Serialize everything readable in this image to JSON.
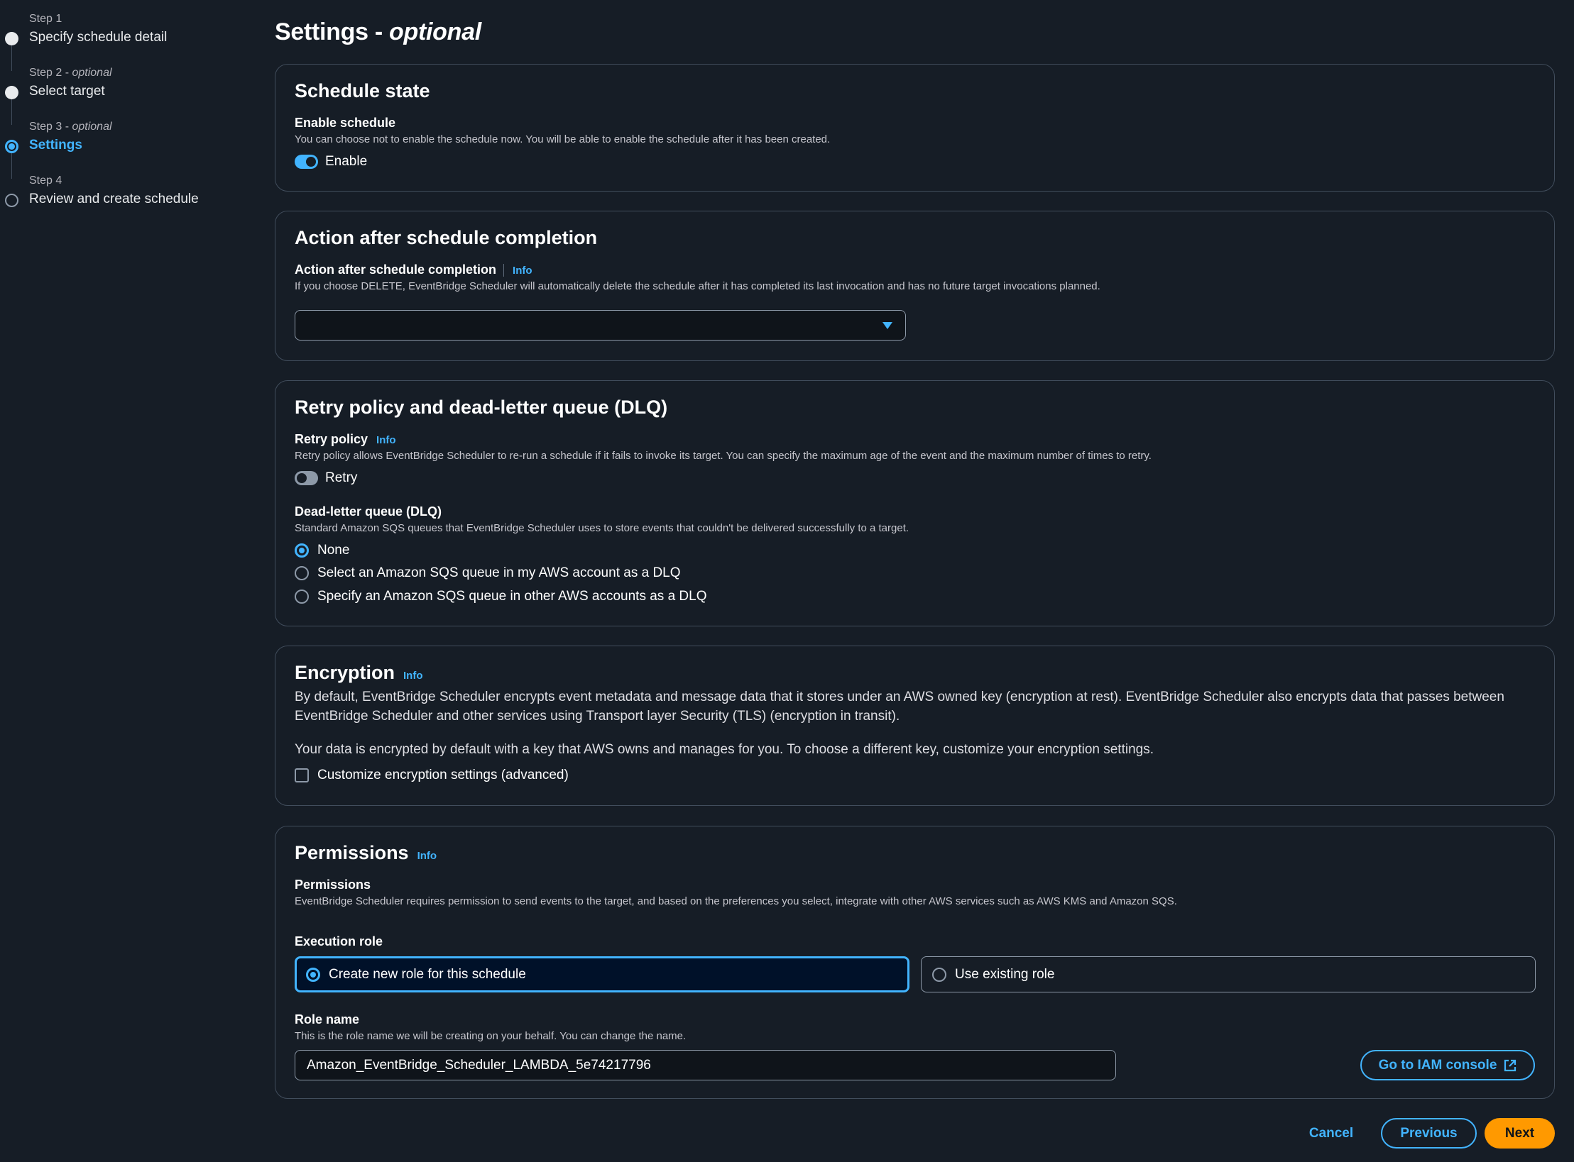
{
  "steps": [
    {
      "num": "Step 1",
      "optional": "",
      "title": "Specify schedule detail"
    },
    {
      "num": "Step 2",
      "optional": "optional",
      "title": "Select target"
    },
    {
      "num": "Step 3",
      "optional": "optional",
      "title": "Settings"
    },
    {
      "num": "Step 4",
      "optional": "",
      "title": "Review and create schedule"
    }
  ],
  "page": {
    "title": "Settings - ",
    "title_suffix": "optional"
  },
  "schedule_state": {
    "title": "Schedule state",
    "label": "Enable schedule",
    "desc": "You can choose not to enable the schedule now. You will be able to enable the schedule after it has been created.",
    "toggle_label": "Enable"
  },
  "completion": {
    "title": "Action after schedule completion",
    "label": "Action after schedule completion",
    "info": "Info",
    "desc": "If you choose DELETE, EventBridge Scheduler will automatically delete the schedule after it has completed its last invocation and has no future target invocations planned.",
    "selected": ""
  },
  "retry": {
    "title": "Retry policy and dead-letter queue (DLQ)",
    "label": "Retry policy",
    "info": "Info",
    "desc": "Retry policy allows EventBridge Scheduler to re-run a schedule if it fails to invoke its target. You can specify the maximum age of the event and the maximum number of times to retry.",
    "toggle_label": "Retry",
    "dlq_label": "Dead-letter queue (DLQ)",
    "dlq_desc": "Standard Amazon SQS queues that EventBridge Scheduler uses to store events that couldn't be delivered successfully to a target.",
    "dlq_options": [
      "None",
      "Select an Amazon SQS queue in my AWS account as a DLQ",
      "Specify an Amazon SQS queue in other AWS accounts as a DLQ"
    ]
  },
  "encryption": {
    "title": "Encryption",
    "info": "Info",
    "desc": "By default, EventBridge Scheduler encrypts event metadata and message data that it stores under an AWS owned key (encryption at rest). EventBridge Scheduler also encrypts data that passes between EventBridge Scheduler and other services using Transport layer Security (TLS) (encryption in transit).",
    "desc2": "Your data is encrypted by default with a key that AWS owns and manages for you. To choose a different key, customize your encryption settings.",
    "checkbox_label": "Customize encryption settings (advanced)"
  },
  "permissions": {
    "title": "Permissions",
    "info": "Info",
    "label": "Permissions",
    "desc": "EventBridge Scheduler requires permission to send events to the target, and based on the preferences you select, integrate with other AWS services such as AWS KMS and Amazon SQS.",
    "exec_label": "Execution role",
    "opt_new": "Create new role for this schedule",
    "opt_existing": "Use existing role",
    "role_label": "Role name",
    "role_desc": "This is the role name we will be creating on your behalf. You can change the name.",
    "role_value": "Amazon_EventBridge_Scheduler_LAMBDA_5e74217796",
    "iam_button": "Go to IAM console"
  },
  "footer": {
    "cancel": "Cancel",
    "previous": "Previous",
    "next": "Next"
  },
  "colors": {
    "accent": "#42b4ff",
    "primary": "#ff9900",
    "background": "#161d26",
    "border": "#414d5c"
  }
}
